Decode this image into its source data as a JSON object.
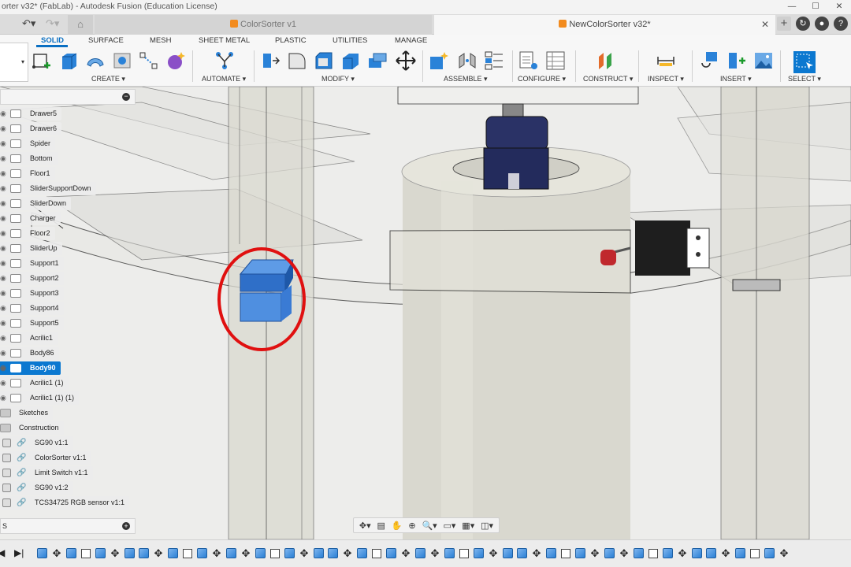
{
  "window": {
    "title": "orter v32* (FabLab) - Autodesk Fusion (Education License)",
    "controls": [
      "—",
      "☐",
      "✕"
    ]
  },
  "tabs": [
    {
      "label": "ColorSorter v1",
      "active": false
    },
    {
      "label": "NewColorSorter v32*",
      "active": true
    }
  ],
  "ribbon": {
    "tabs": [
      "SOLID",
      "SURFACE",
      "MESH",
      "SHEET METAL",
      "PLASTIC",
      "UTILITIES",
      "MANAGE"
    ],
    "groups": [
      "CREATE ▾",
      "AUTOMATE ▾",
      "MODIFY ▾",
      "ASSEMBLE ▾",
      "CONFIGURE ▾",
      "CONSTRUCT ▾",
      "INSPECT ▾",
      "INSERT ▾",
      "SELECT ▾"
    ],
    "workspace": "▾"
  },
  "browser": {
    "bodies": [
      "Drawer5",
      "Drawer6",
      "Spider",
      "Bottom",
      "Floor1",
      "SliderSupportDown",
      "SliderDown",
      "Charger",
      "Floor2",
      "SliderUp",
      "Support1",
      "Support2",
      "Support3",
      "Support4",
      "Support5",
      "Acrilic1",
      "Body86",
      "Body90",
      "Acrilic1 (1)",
      "Acrilic1 (1) (1)"
    ],
    "selected": "Body90",
    "folders": [
      "Sketches",
      "Construction"
    ],
    "components": [
      "SG90 v1:1",
      "ColorSorter v1:1",
      "Limit Switch v1:1",
      "SG90 v1:2",
      "TCS34725 RGB sensor v1:1"
    ],
    "collapse": "−",
    "comments_label": "S",
    "comments_add": "+"
  },
  "navbar": {
    "items": [
      "✥▾",
      "▤",
      "✋",
      "⊕",
      "🔍▾",
      "▭▾",
      "▦▾",
      "◫▾"
    ]
  },
  "timeline": {
    "controls": [
      "|◀",
      "◀",
      "▶",
      "▶|"
    ]
  },
  "colors": {
    "accent": "#0a6fc2",
    "selection": "#0b78d0",
    "highlight_circle": "#e01010"
  }
}
